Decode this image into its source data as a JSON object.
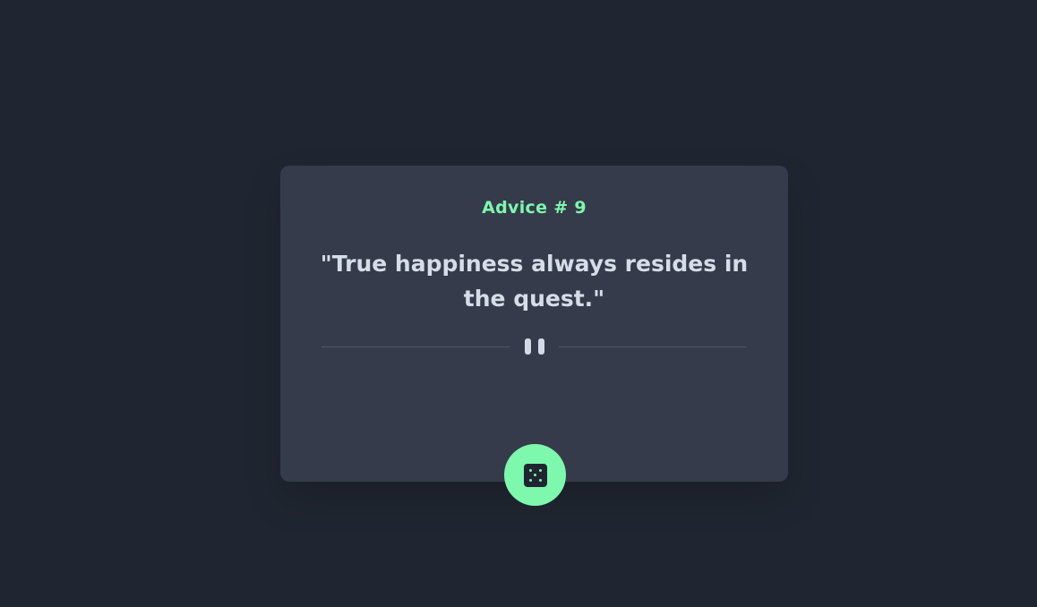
{
  "advice": {
    "id_label": "Advice # 9",
    "text": "\"True happiness always resides in the quest.\""
  },
  "controls": {
    "divider_icon": "pause-icon",
    "generate_button_icon": "dice-icon"
  },
  "colors": {
    "background": "#202631",
    "card": "#353b4a",
    "accent": "#7ef8ad",
    "text": "#d5dde9"
  }
}
